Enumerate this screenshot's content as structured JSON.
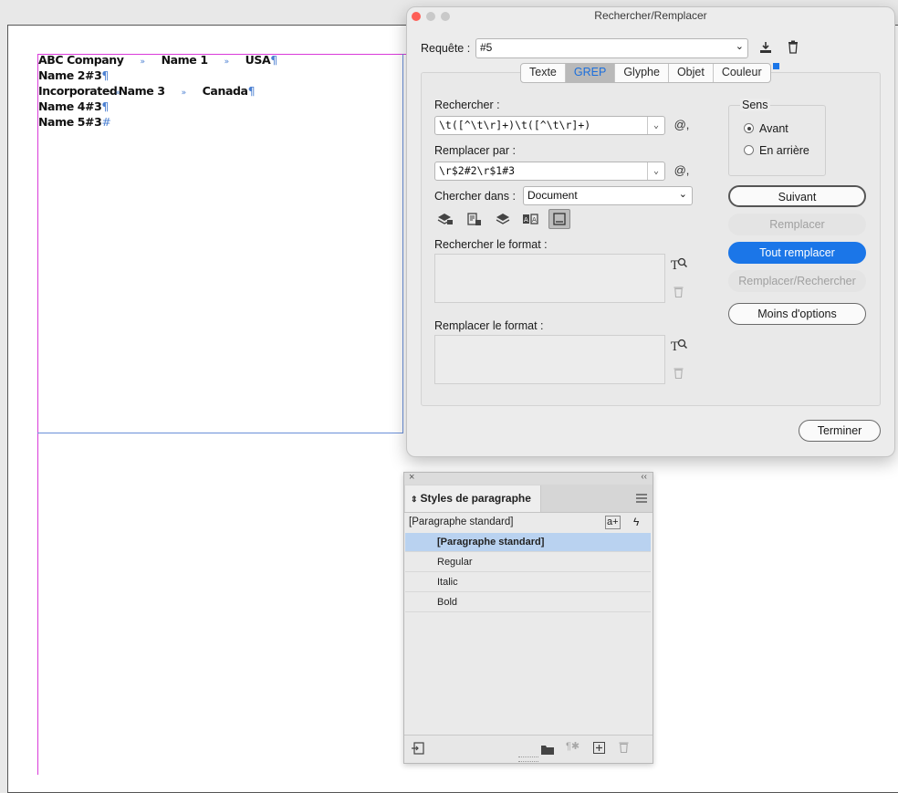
{
  "document": {
    "lines": [
      {
        "c1": "ABC Company",
        "c2": "Name 1",
        "c3": "USA",
        "end": "¶"
      },
      {
        "c1": "Name 2#3",
        "end": "¶"
      },
      {
        "c1": "Incorporated",
        "c2": "Name 3",
        "c3": "Canada",
        "end": "¶"
      },
      {
        "c1": "Name 4#3",
        "end": "¶"
      },
      {
        "c1": "Name 5#3",
        "end": "#"
      }
    ],
    "tab_glyph": "»"
  },
  "dialog": {
    "title": "Rechercher/Remplacer",
    "query_label": "Requête :",
    "query_value": "#5",
    "tabs": [
      "Texte",
      "GREP",
      "Glyphe",
      "Objet",
      "Couleur"
    ],
    "active_tab": "GREP",
    "find_label": "Rechercher :",
    "find_value": "\\t([^\\t\\r]+)\\t([^\\t\\r]+)",
    "replace_label": "Remplacer par :",
    "replace_value": "\\r$2#2\\r$1#3",
    "search_in_label": "Chercher dans :",
    "search_in_value": "Document",
    "find_format_label": "Rechercher le format :",
    "replace_format_label": "Remplacer le format :",
    "direction_label": "Sens",
    "direction_forward": "Avant",
    "direction_backward": "En arrière",
    "direction_selected": "Avant",
    "btn_next": "Suivant",
    "btn_replace": "Remplacer",
    "btn_replace_all": "Tout remplacer",
    "btn_replace_find": "Remplacer/Rechercher",
    "btn_fewer": "Moins d'options",
    "btn_done": "Terminer",
    "special_char": "@,",
    "colors": {
      "accent": "#1b76e8"
    }
  },
  "styles_panel": {
    "title": "Styles de paragraphe",
    "current": "[Paragraphe standard]",
    "items": [
      "[Paragraphe standard]",
      "Regular",
      "Italic",
      "Bold"
    ],
    "selected": "[Paragraphe standard]"
  }
}
